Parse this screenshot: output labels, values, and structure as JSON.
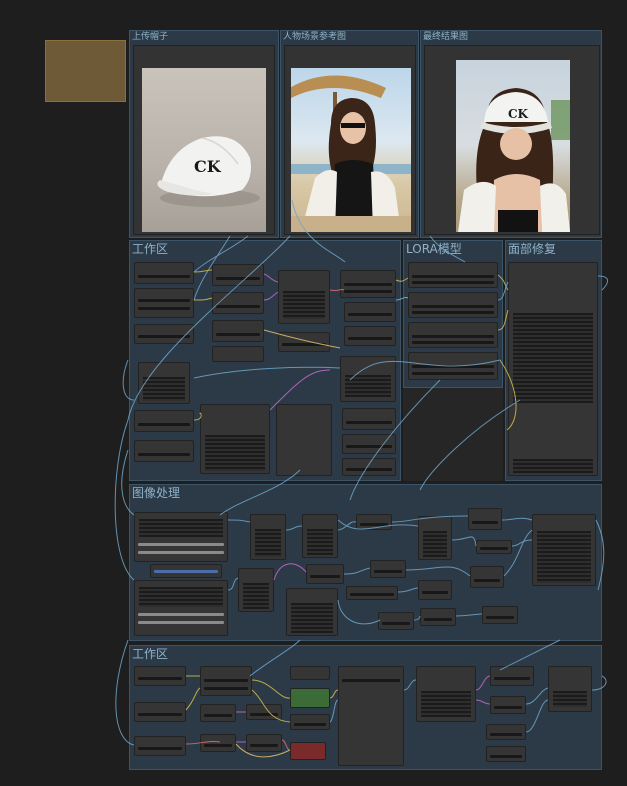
{
  "groups": {
    "upload_hat": "上传帽子",
    "person_ref": "人物场景参考图",
    "output_preview": "最终结果图",
    "workspace_1": "工作区",
    "lora": "LORA模型",
    "face_fix": "面部修复",
    "image_processing": "图像处理",
    "workspace_2": "工作区"
  },
  "colors": {
    "canvas": "#1e1e1e",
    "group_bg": "#2c3a47",
    "group_title": "#8fb2c9",
    "note": "#6e5a37",
    "node_green": "#3b6b37",
    "node_red": "#7a2a2a"
  },
  "images": {
    "hat": {
      "logo_text": "CK"
    },
    "person": {
      "logo_text": ""
    },
    "result": {
      "logo_text": "CK"
    }
  }
}
